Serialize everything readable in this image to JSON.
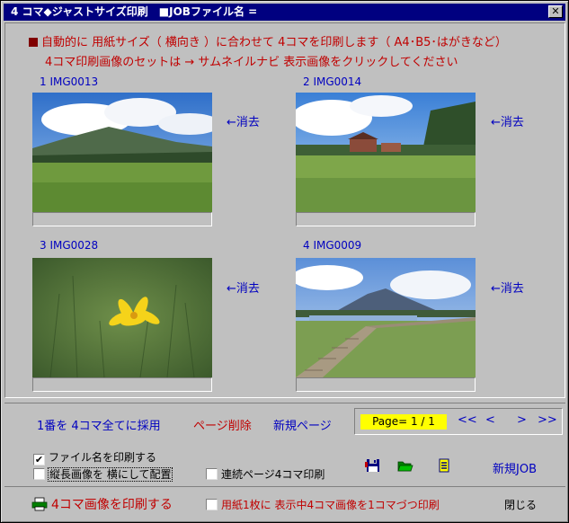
{
  "window": {
    "title": "4 コマ◆ジャストサイズ印刷　■JOBファイル名 ="
  },
  "instructions": {
    "line1": "自動的に 用紙サイズ（ 横向き ）に合わせて 4コマを印刷します（ A4･B5･はがきなど）",
    "line2": "4コマ印刷画像のセットは → サムネイルナビ 表示画像をクリックしてください"
  },
  "slots": [
    {
      "label": "1  IMG0013",
      "delete_label": "←消去"
    },
    {
      "label": "2  IMG0014",
      "delete_label": "←消去"
    },
    {
      "label": "3  IMG0028",
      "delete_label": "←消去"
    },
    {
      "label": "4  IMG0009",
      "delete_label": "←消去"
    }
  ],
  "nav": {
    "adopt_all": "1番を 4コマ全てに採用",
    "delete_page": "ページ削除",
    "new_page": "新規ページ",
    "page_indicator": "Page= 1 / 1",
    "first": "<<",
    "prev": "<",
    "next": ">",
    "last": ">>"
  },
  "options": {
    "print_filename": {
      "label": "ファイル名を印刷する",
      "checked": true
    },
    "rotate_portrait": {
      "label": "縦長画像を 横にして配置",
      "checked": false
    },
    "continuous_pages": {
      "label": "連続ページ4コマ印刷",
      "checked": false
    },
    "one_per_sheet": {
      "label": "用紙1枚に 表示中4コマ画像を1コマづつ印刷",
      "checked": false
    }
  },
  "toolbar": {
    "save_icon": "floppy-disk-icon",
    "open_icon": "folder-open-icon",
    "copy_icon": "document-copy-icon",
    "new_job": "新規JOB"
  },
  "footer": {
    "print_button": "4コマ画像を印刷する",
    "close_label": "閉じる"
  },
  "colors": {
    "title_bar": "#000080",
    "instruction_red": "#c00000",
    "link_blue": "#0000c0",
    "page_indicator_bg": "#ffff00"
  }
}
